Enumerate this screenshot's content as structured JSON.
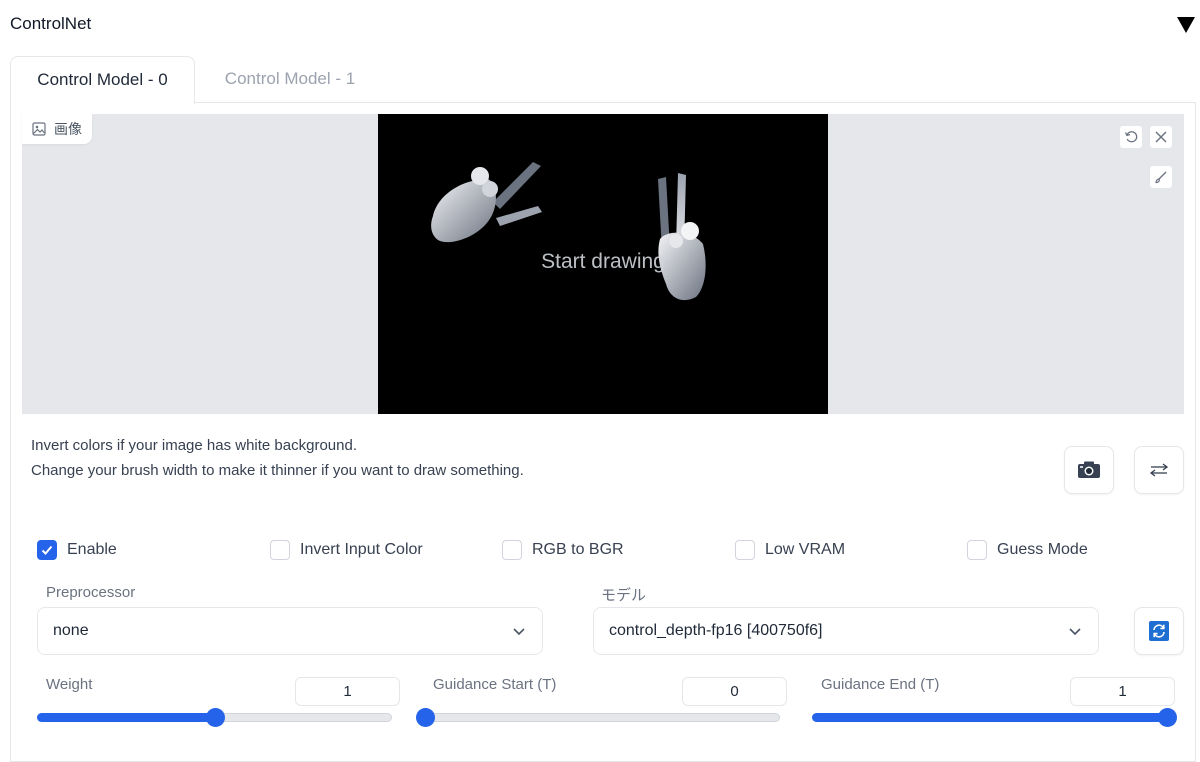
{
  "header": {
    "title": "ControlNet"
  },
  "tabs": [
    {
      "label": "Control Model - 0",
      "active": true
    },
    {
      "label": "Control Model - 1",
      "active": false
    }
  ],
  "image_panel": {
    "label": "画像",
    "canvas_placeholder": "Start drawing"
  },
  "hints": [
    "Invert colors if your image has white background.",
    "Change your brush width to make it thinner if you want to draw something."
  ],
  "checkboxes": [
    {
      "label": "Enable",
      "checked": true
    },
    {
      "label": "Invert Input Color",
      "checked": false
    },
    {
      "label": "RGB to BGR",
      "checked": false
    },
    {
      "label": "Low VRAM",
      "checked": false
    },
    {
      "label": "Guess Mode",
      "checked": false
    }
  ],
  "preprocessor": {
    "label": "Preprocessor",
    "value": "none"
  },
  "model": {
    "label": "モデル",
    "value": "control_depth-fp16 [400750f6]"
  },
  "sliders": [
    {
      "label": "Weight",
      "value": "1",
      "fraction": 0.5
    },
    {
      "label": "Guidance Start (T)",
      "value": "0",
      "fraction": 0.0
    },
    {
      "label": "Guidance End (T)",
      "value": "1",
      "fraction": 1.0
    }
  ],
  "colors": {
    "accent": "#2563eb",
    "canvas": "#000000",
    "panel_bg": "#e5e7eb"
  },
  "icons": {
    "collapse": "triangle-down-icon",
    "image_label": "image-icon",
    "undo": "undo-icon",
    "clear": "close-icon",
    "brush": "brush-icon",
    "camera": "camera-icon",
    "swap": "swap-arrows-icon",
    "refresh": "refresh-icon",
    "dropdown": "chevron-down-icon"
  }
}
